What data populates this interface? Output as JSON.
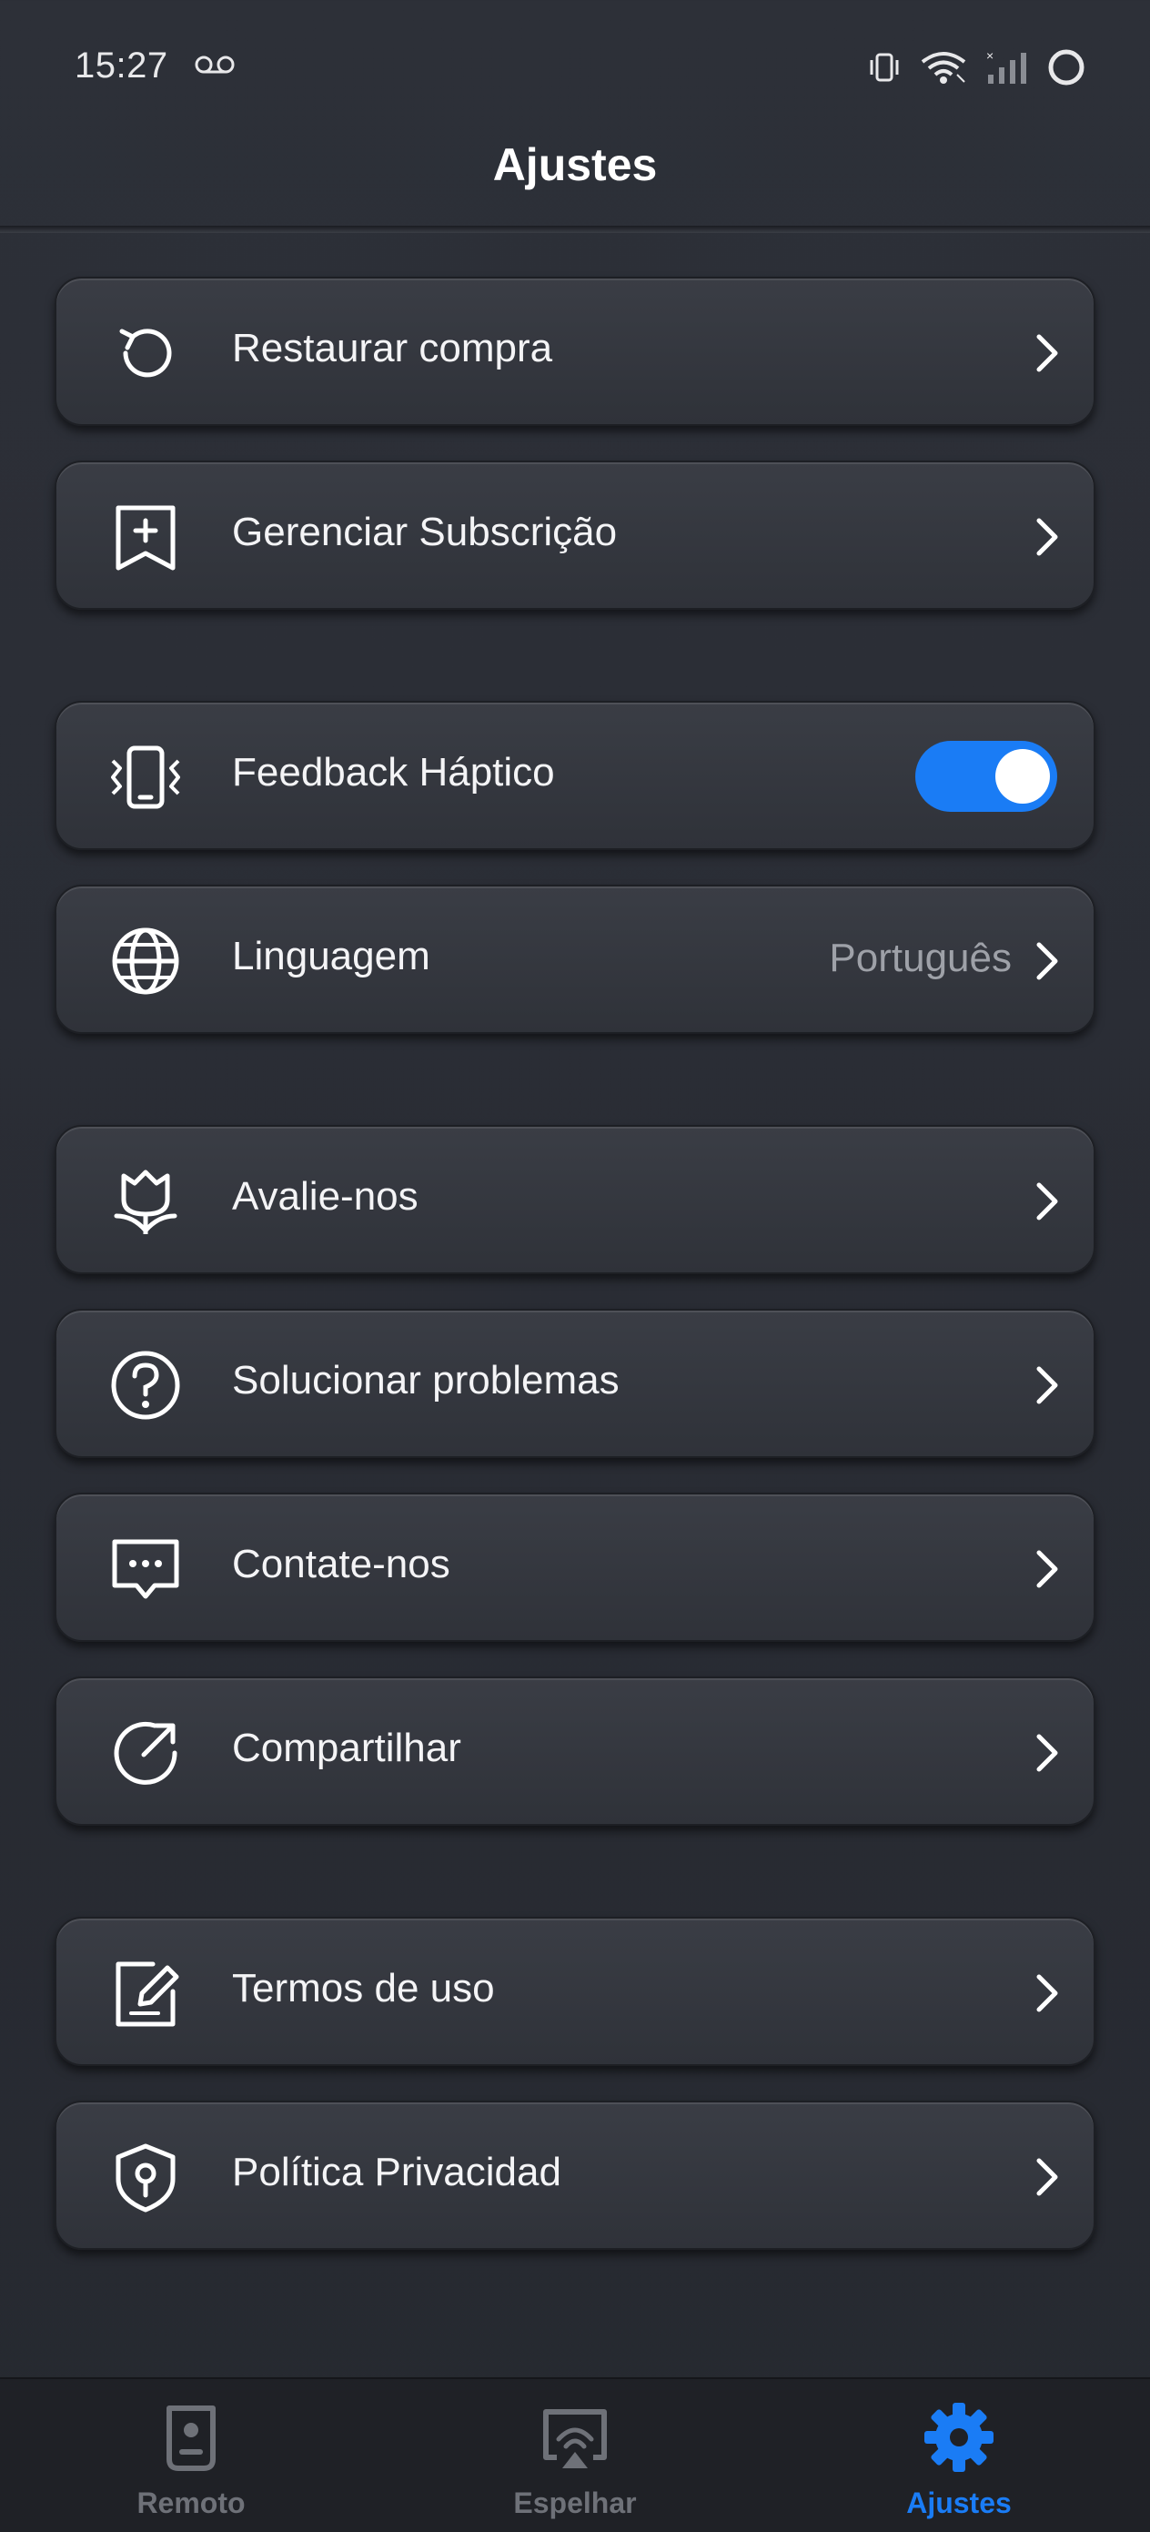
{
  "status_bar": {
    "time": "15:27"
  },
  "header": {
    "title": "Ajustes"
  },
  "groups": [
    {
      "items": [
        {
          "id": "restaurar",
          "icon": "restore-icon",
          "label": "Restaurar compra"
        },
        {
          "id": "gerenciar",
          "icon": "subscription-bookmark-icon",
          "label": "Gerenciar Subscrição"
        }
      ]
    },
    {
      "items": [
        {
          "id": "haptic",
          "icon": "phone-vibrate-icon",
          "label": "Feedback Háptico",
          "toggle_on": true
        },
        {
          "id": "linguagem",
          "icon": "globe-icon",
          "label": "Linguagem",
          "value": "Português"
        }
      ]
    },
    {
      "items": [
        {
          "id": "avalie",
          "icon": "flower-icon",
          "label": "Avalie-nos"
        },
        {
          "id": "solucionar",
          "icon": "question-circle-icon",
          "label": "Solucionar problemas"
        },
        {
          "id": "contate",
          "icon": "chat-bubble-icon",
          "label": "Contate-nos"
        },
        {
          "id": "compartilhar",
          "icon": "share-arrow-icon",
          "label": "Compartilhar"
        }
      ]
    },
    {
      "items": [
        {
          "id": "termos",
          "icon": "edit-document-icon",
          "label": "Termos de uso"
        },
        {
          "id": "politica",
          "icon": "shield-key-icon",
          "label": "Política Privacidad"
        }
      ]
    }
  ],
  "tabbar": {
    "active": "ajustes",
    "active_color": "#1a7cf5",
    "tabs": [
      {
        "id": "remoto",
        "icon": "remote-icon",
        "label": "Remoto"
      },
      {
        "id": "espelhar",
        "icon": "screen-mirror-icon",
        "label": "Espelhar"
      },
      {
        "id": "ajustes",
        "icon": "gear-icon",
        "label": "Ajustes"
      }
    ]
  }
}
